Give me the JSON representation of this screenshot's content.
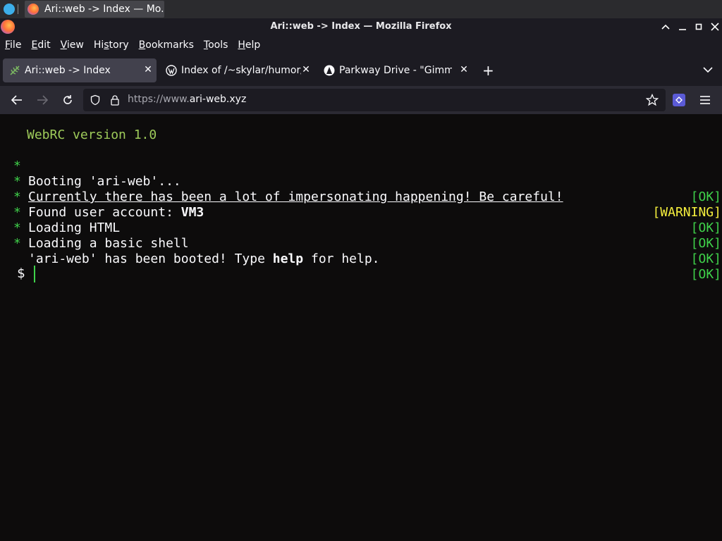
{
  "taskbar": {
    "task_title": "Ari::web -> Index — Mo..."
  },
  "window": {
    "title": "Ari::web -> Index — Mozilla Firefox",
    "minimize": "−",
    "maximize": "□",
    "close": "✕"
  },
  "menu": [
    "File",
    "Edit",
    "View",
    "History",
    "Bookmarks",
    "Tools",
    "Help"
  ],
  "menu_first_letters": [
    "F",
    "E",
    "V",
    "H",
    "B",
    "T",
    "H"
  ],
  "tabs": [
    {
      "label": "Ari::web -> Index",
      "icon": "leaf-icon",
      "active": true
    },
    {
      "label": "Index of /~skylar/humor/",
      "icon": "wordpress-icon",
      "active": false
    },
    {
      "label": "Parkway Drive - \"Gimme",
      "icon": "triangle-icon",
      "active": false
    }
  ],
  "tab_close": "✕",
  "new_tab": "+",
  "url": {
    "scheme": "https://www.",
    "host": "ari-web.xyz"
  },
  "terminal": {
    "version": "WebRC version 1.0",
    "bullet": "*",
    "lines": [
      {
        "pre": "Booting 'ari-web'...",
        "bold": "",
        "post": "",
        "status": "[OK]"
      },
      {
        "pre": "Currently there has been a lot of impersonating happening! Be careful!",
        "bold": "",
        "post": "",
        "status": "[WARNING]"
      },
      {
        "pre": "Found user account: ",
        "bold": "VM3",
        "post": "",
        "status": "[OK]"
      },
      {
        "pre": "Loading HTML",
        "bold": "",
        "post": "",
        "status": "[OK]"
      },
      {
        "pre": "Loading a basic shell",
        "bold": "",
        "post": "",
        "status": "[OK]"
      },
      {
        "pre": "'ari-web' has been booted! Type ",
        "bold": "help",
        "post": " for help.",
        "status": "[OK]"
      }
    ],
    "prompt": "$"
  },
  "colors": {
    "ok": "#3fd14a",
    "warning": "#f5ef3d",
    "version": "#9ecb5a",
    "background": "#0d0c0c"
  }
}
